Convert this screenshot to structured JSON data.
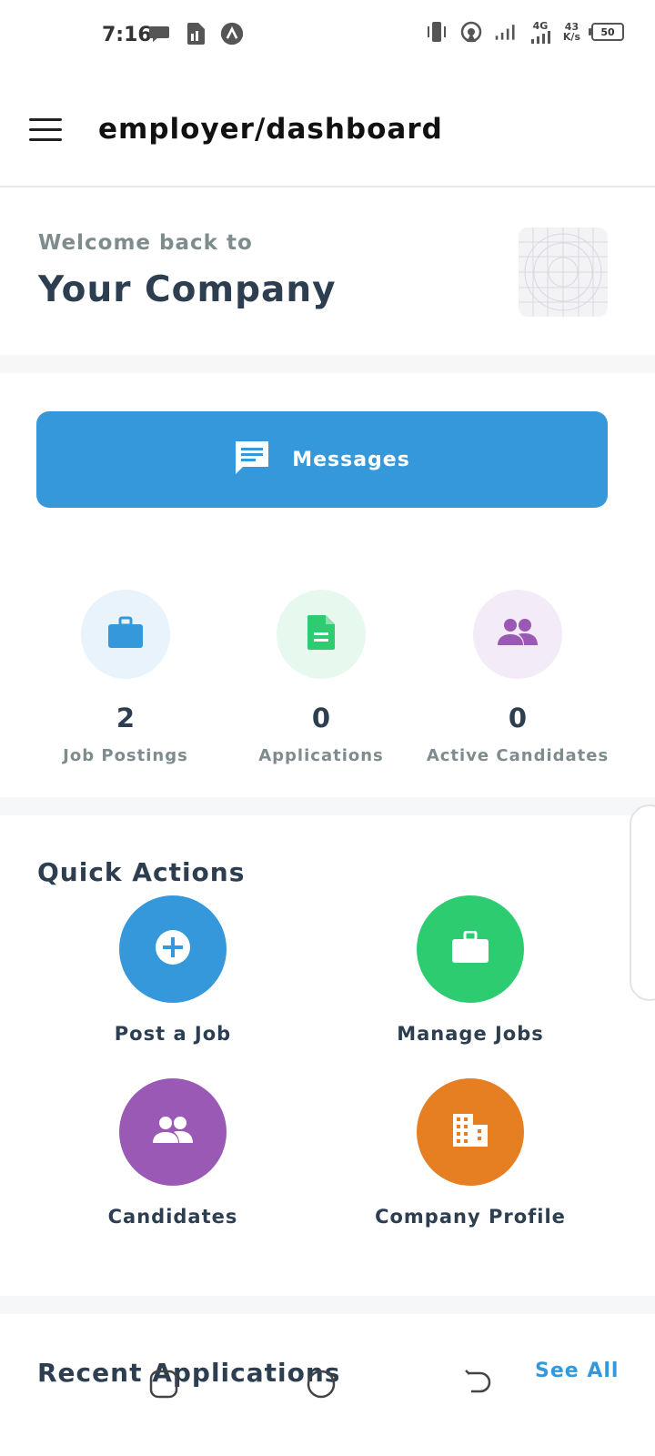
{
  "status_bar": {
    "time": "7:16",
    "network_type": "4G",
    "speed_value": "43",
    "speed_unit": "K/s",
    "battery": "50"
  },
  "app_bar": {
    "title": "employer/dashboard"
  },
  "welcome": {
    "subtitle": "Welcome back to",
    "company_name": "Your Company"
  },
  "messages_button": {
    "label": "Messages"
  },
  "stats": [
    {
      "value": "2",
      "label": "Job Postings",
      "color": "#3498db",
      "bg": "#e8f3fc",
      "icon": "briefcase-icon"
    },
    {
      "value": "0",
      "label": "Applications",
      "color": "#2ecc71",
      "bg": "#e7f8ee",
      "icon": "document-icon"
    },
    {
      "value": "0",
      "label": "Active Candidates",
      "color": "#9b59b6",
      "bg": "#f3ebf7",
      "icon": "people-icon"
    }
  ],
  "quick_actions": {
    "title": "Quick Actions",
    "items": [
      {
        "label": "Post a Job",
        "color": "#3498db",
        "icon": "add-circle-icon"
      },
      {
        "label": "Manage Jobs",
        "color": "#2ecc71",
        "icon": "briefcase-icon"
      },
      {
        "label": "Candidates",
        "color": "#9b59b6",
        "icon": "people-icon"
      },
      {
        "label": "Company Profile",
        "color": "#e67e22",
        "icon": "building-icon"
      }
    ]
  },
  "recent_applications": {
    "title": "Recent Applications",
    "see_all": "See All"
  }
}
